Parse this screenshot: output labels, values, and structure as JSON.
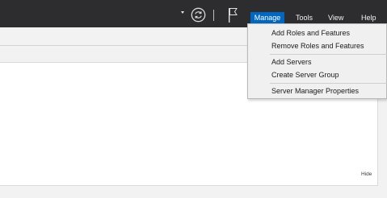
{
  "header": {
    "menus": [
      {
        "label": "Manage"
      },
      {
        "label": "Tools"
      },
      {
        "label": "View"
      },
      {
        "label": "Help"
      }
    ],
    "icons": [
      "chevron-down-icon",
      "refresh-icon",
      "notifications-flag-icon"
    ],
    "accent_color": "#0067c0"
  },
  "manage_menu": {
    "items": [
      {
        "label": "Add Roles and Features"
      },
      {
        "label": "Remove Roles and Features"
      },
      {
        "label": "Add Servers"
      },
      {
        "label": "Create Server Group"
      },
      {
        "label": "Server Manager Properties"
      }
    ]
  },
  "panel": {
    "hide_label": "Hide"
  }
}
